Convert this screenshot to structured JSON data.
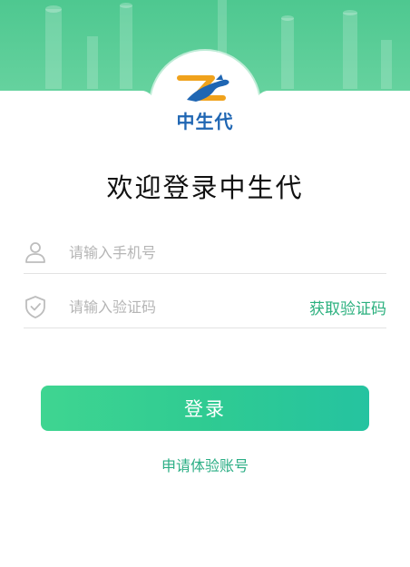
{
  "logo": {
    "brand_text": "中生代"
  },
  "welcome_title": "欢迎登录中生代",
  "phone_field": {
    "placeholder": "请输入手机号",
    "value": "",
    "icon": "user-icon"
  },
  "code_field": {
    "placeholder": "请输入验证码",
    "value": "",
    "icon": "shield-check-icon"
  },
  "get_code_label": "获取验证码",
  "login_button_label": "登录",
  "trial_link_label": "申请体验账号",
  "colors": {
    "accent_green": "#2bb07e",
    "hero_green": "#5ccf97",
    "logo_blue": "#1f66b3",
    "logo_orange": "#f0a21c"
  }
}
